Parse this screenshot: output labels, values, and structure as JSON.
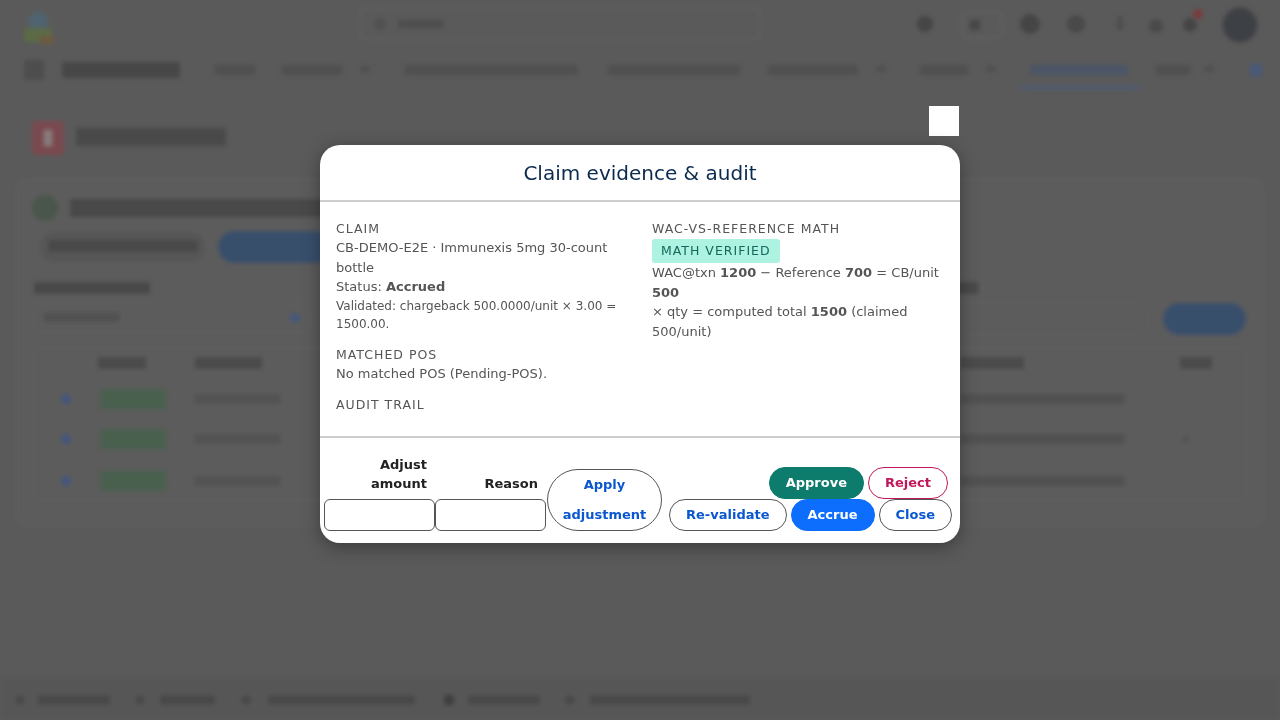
{
  "dialog": {
    "title": "Claim evidence & audit"
  },
  "left_sections": [
    {
      "heading": "CLAIM",
      "lines": [
        {
          "kind": "text",
          "text": "CB-DEMO-E2E · Immunexis 5mg 30-count bottle"
        },
        {
          "kind": "text",
          "text": "Status: **Accrued**"
        },
        {
          "kind": "note",
          "text": "Validated: chargeback 500.0000/unit × 3.00 = 1500.00."
        }
      ]
    },
    {
      "heading": "MATCHED POS",
      "lines": [
        {
          "kind": "text",
          "text": "No matched POS (Pending-POS)."
        }
      ]
    },
    {
      "heading": "AUDIT TRAIL"
    }
  ],
  "right_sections": [
    {
      "heading": "WAC-VS-REFERENCE MATH",
      "badge": "MATH VERIFIED",
      "lines": [
        {
          "kind": "text",
          "text": "WAC@txn **1200** − Reference **700** = CB/unit **500**"
        },
        {
          "kind": "text",
          "text": "× qty = computed total **1500** (claimed 500/unit)"
        }
      ]
    }
  ],
  "footer": {
    "fields": [
      {
        "label": "Adjust amount"
      },
      {
        "label": "Reason"
      }
    ],
    "apply_button": "Apply adjustment",
    "action_rows": [
      [
        {
          "label": "Approve",
          "kind": "success"
        },
        {
          "label": "Reject",
          "kind": "danger-outline"
        }
      ],
      [
        {
          "label": "Re-validate",
          "kind": "outline"
        },
        {
          "label": "Accrue",
          "kind": "primary"
        },
        {
          "label": "Close",
          "kind": "outline"
        }
      ]
    ]
  }
}
